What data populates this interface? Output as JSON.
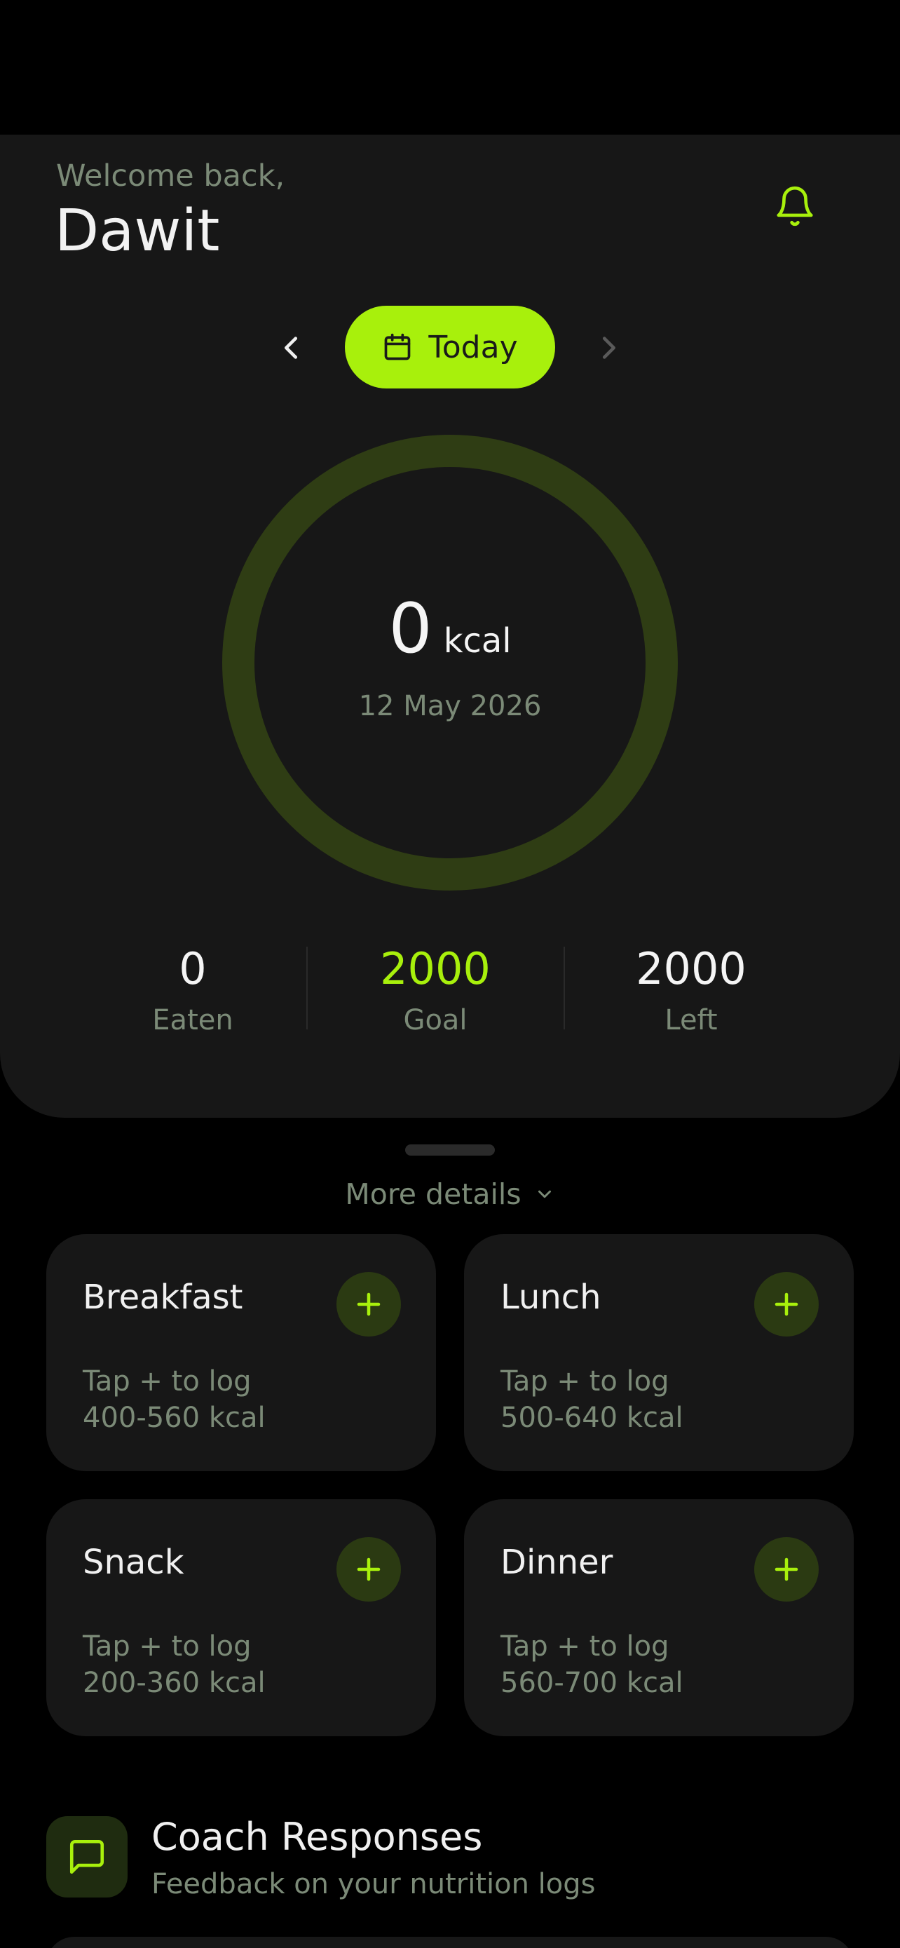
{
  "header": {
    "welcome": "Welcome back,",
    "user_name": "Dawit",
    "notification_icon": "bell-icon"
  },
  "date_nav": {
    "prev_icon": "chevron-left-icon",
    "next_icon": "chevron-right-icon",
    "today_icon": "calendar-icon",
    "today_label": "Today"
  },
  "calories": {
    "value": "0",
    "unit": "kcal",
    "date": "12 May 2026",
    "progress": 0
  },
  "stats": [
    {
      "value": "0",
      "label": "Eaten"
    },
    {
      "value": "2000",
      "label": "Goal"
    },
    {
      "value": "2000",
      "label": "Left"
    }
  ],
  "more_details": {
    "label": "More details",
    "icon": "chevron-down-icon"
  },
  "meals": [
    {
      "title": "Breakfast",
      "hint": "Tap + to log",
      "range": "400-560 kcal"
    },
    {
      "title": "Lunch",
      "hint": "Tap + to log",
      "range": "500-640 kcal"
    },
    {
      "title": "Snack",
      "hint": "Tap + to log",
      "range": "200-360 kcal"
    },
    {
      "title": "Dinner",
      "hint": "Tap + to log",
      "range": "560-700 kcal"
    }
  ],
  "coach": {
    "title": "Coach Responses",
    "subtitle": "Feedback on your nutrition logs",
    "icon": "message-square-icon"
  },
  "colors": {
    "accent": "#a8f00c",
    "card": "#171717",
    "muted_text": "#7b8a77",
    "ring_track": "#2f3d14",
    "background": "#000000"
  }
}
